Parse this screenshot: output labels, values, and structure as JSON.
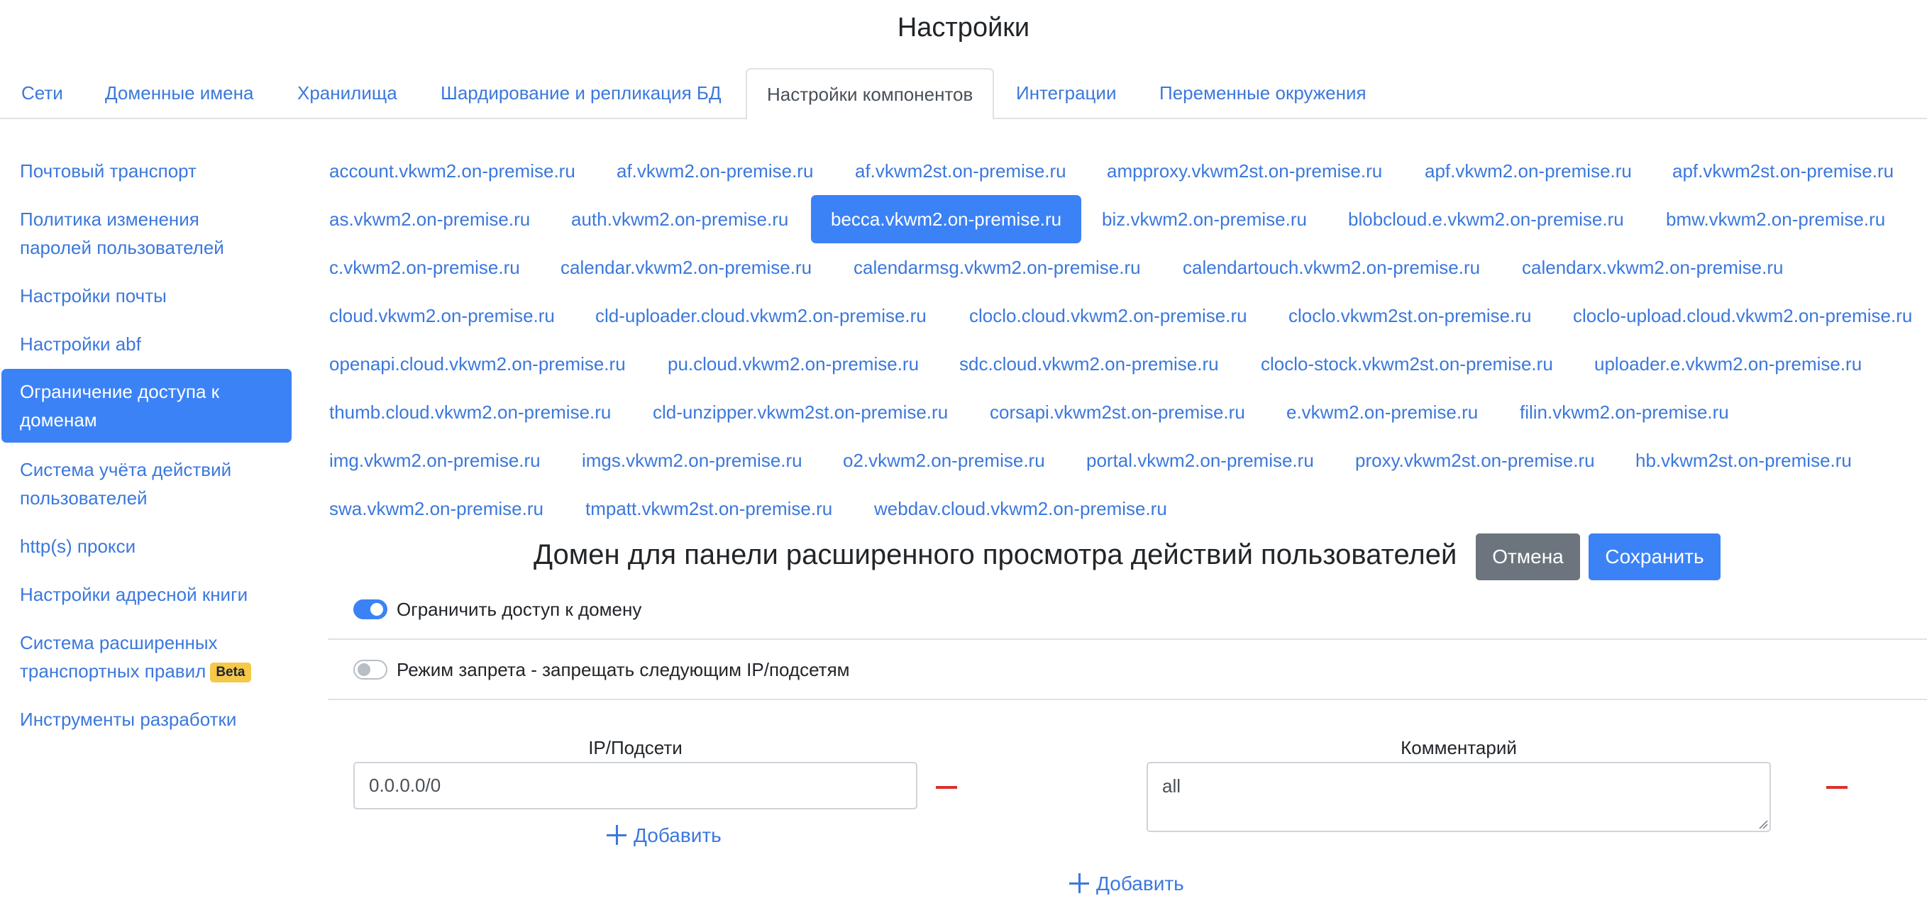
{
  "page": {
    "title": "Настройки"
  },
  "tabs": [
    {
      "label": "Сети"
    },
    {
      "label": "Доменные имена"
    },
    {
      "label": "Хранилища"
    },
    {
      "label": "Шардирование и репликация БД"
    },
    {
      "label": "Настройки компонентов",
      "active": true
    },
    {
      "label": "Интеграции"
    },
    {
      "label": "Переменные окружения"
    }
  ],
  "sidebar": {
    "items": [
      {
        "label": "Почтовый транспорт"
      },
      {
        "label": "Политика изменения паролей пользователей"
      },
      {
        "label": "Настройки почты"
      },
      {
        "label": "Настройки abf"
      },
      {
        "label": "Ограничение доступа к доменам",
        "active": true
      },
      {
        "label": "Система учёта действий пользователей"
      },
      {
        "label": "http(s) прокси"
      },
      {
        "label": "Настройки адресной книги"
      },
      {
        "label": "Система расширенных транспортных правил",
        "badge": "Beta"
      },
      {
        "label": "Инструменты разработки"
      }
    ]
  },
  "domains": [
    "account.vkwm2.on-premise.ru",
    "af.vkwm2.on-premise.ru",
    "af.vkwm2st.on-premise.ru",
    "ampproxy.vkwm2st.on-premise.ru",
    "apf.vkwm2.on-premise.ru",
    "apf.vkwm2st.on-premise.ru",
    "as.vkwm2.on-premise.ru",
    "auth.vkwm2.on-premise.ru",
    "becca.vkwm2.on-premise.ru",
    "biz.vkwm2.on-premise.ru",
    "blobcloud.e.vkwm2.on-premise.ru",
    "bmw.vkwm2.on-premise.ru",
    "c.vkwm2.on-premise.ru",
    "calendar.vkwm2.on-premise.ru",
    "calendarmsg.vkwm2.on-premise.ru",
    "calendartouch.vkwm2.on-premise.ru",
    "calendarx.vkwm2.on-premise.ru",
    "cloud.vkwm2.on-premise.ru",
    "cld-uploader.cloud.vkwm2.on-premise.ru",
    "cloclo.cloud.vkwm2.on-premise.ru",
    "cloclo.vkwm2st.on-premise.ru",
    "cloclo-upload.cloud.vkwm2.on-premise.ru",
    "openapi.cloud.vkwm2.on-premise.ru",
    "pu.cloud.vkwm2.on-premise.ru",
    "sdc.cloud.vkwm2.on-premise.ru",
    "cloclo-stock.vkwm2st.on-premise.ru",
    "uploader.e.vkwm2.on-premise.ru",
    "thumb.cloud.vkwm2.on-premise.ru",
    "cld-unzipper.vkwm2st.on-premise.ru",
    "corsapi.vkwm2st.on-premise.ru",
    "e.vkwm2.on-premise.ru",
    "filin.vkwm2.on-premise.ru",
    "img.vkwm2.on-premise.ru",
    "imgs.vkwm2.on-premise.ru",
    "o2.vkwm2.on-premise.ru",
    "portal.vkwm2.on-premise.ru",
    "proxy.vkwm2st.on-premise.ru",
    "hb.vkwm2st.on-premise.ru",
    "swa.vkwm2.on-premise.ru",
    "tmpatt.vkwm2st.on-premise.ru",
    "webdav.cloud.vkwm2.on-premise.ru"
  ],
  "selected_domain": "becca.vkwm2.on-premise.ru",
  "form": {
    "title": "Домен для панели расширенного просмотра действий пользователей",
    "cancel_label": "Отмена",
    "save_label": "Сохранить",
    "restrict_access": {
      "label": "Ограничить доступ к домену",
      "enabled": true
    },
    "deny_mode": {
      "label": "Режим запрета - запрещать следующим IP/подсетям",
      "enabled": false
    },
    "ip_header": "IP/Подсети",
    "comment_header": "Комментарий",
    "rows": [
      {
        "ip": "0.0.0.0/0",
        "comment": "all"
      }
    ],
    "add_label": "Добавить"
  },
  "colors": {
    "accent": "#3b82f6",
    "link": "#3b78dd",
    "danger": "#d9312b",
    "secondary": "#6c757d",
    "badge": "#f5c84a"
  }
}
